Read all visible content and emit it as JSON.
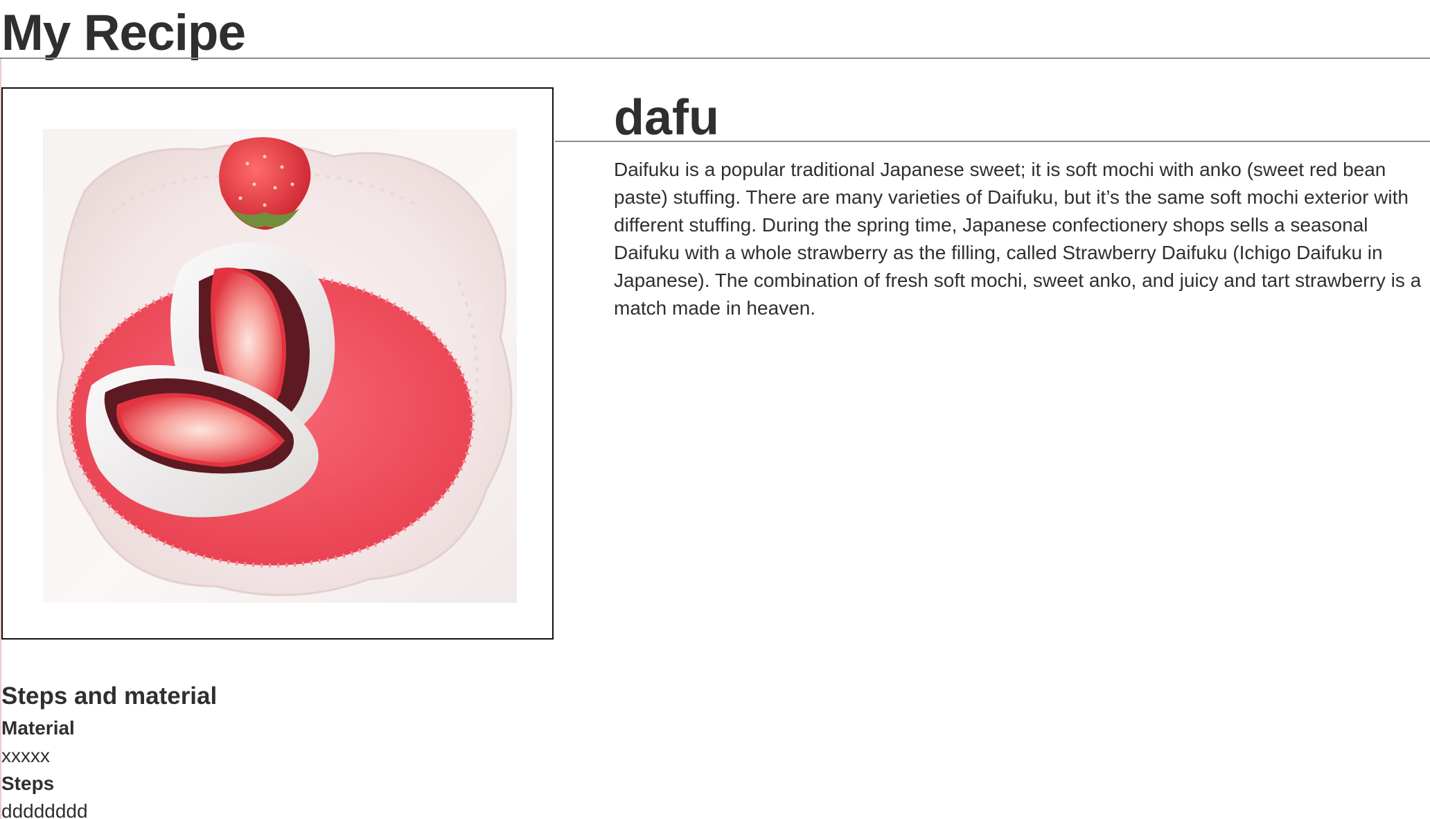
{
  "page": {
    "title": "My Recipe"
  },
  "recipe": {
    "name": "dafu",
    "description": "Daifuku is a popular traditional Japanese sweet; it is soft mochi with anko (sweet red bean paste) stuffing. There are many varieties of Daifuku, but it’s the same soft mochi exterior with different stuffing. During the spring time, Japanese confectionery shops sells a seasonal Daifuku with a whole strawberry as the filling, called Strawberry Daifuku (Ichigo Daifuku in Japanese). The combination of fresh soft mochi, sweet anko, and juicy and tart strawberry is a match made in heaven.",
    "image_icon": "strawberry-daifuku-photo"
  },
  "steps_section": {
    "heading": "Steps and material",
    "material_label": "Material",
    "material_text": "xxxxx",
    "steps_label": "Steps",
    "steps_text": "dddddddd"
  },
  "colors": {
    "text": "#2f2f2f",
    "rule": "#8a8a8a",
    "frame_border": "#111111",
    "cup_red": "#ef4f5e",
    "strawberry_red": "#e0303b",
    "bean_paste": "#5e1a22",
    "mochi": "#f3f0f0"
  }
}
